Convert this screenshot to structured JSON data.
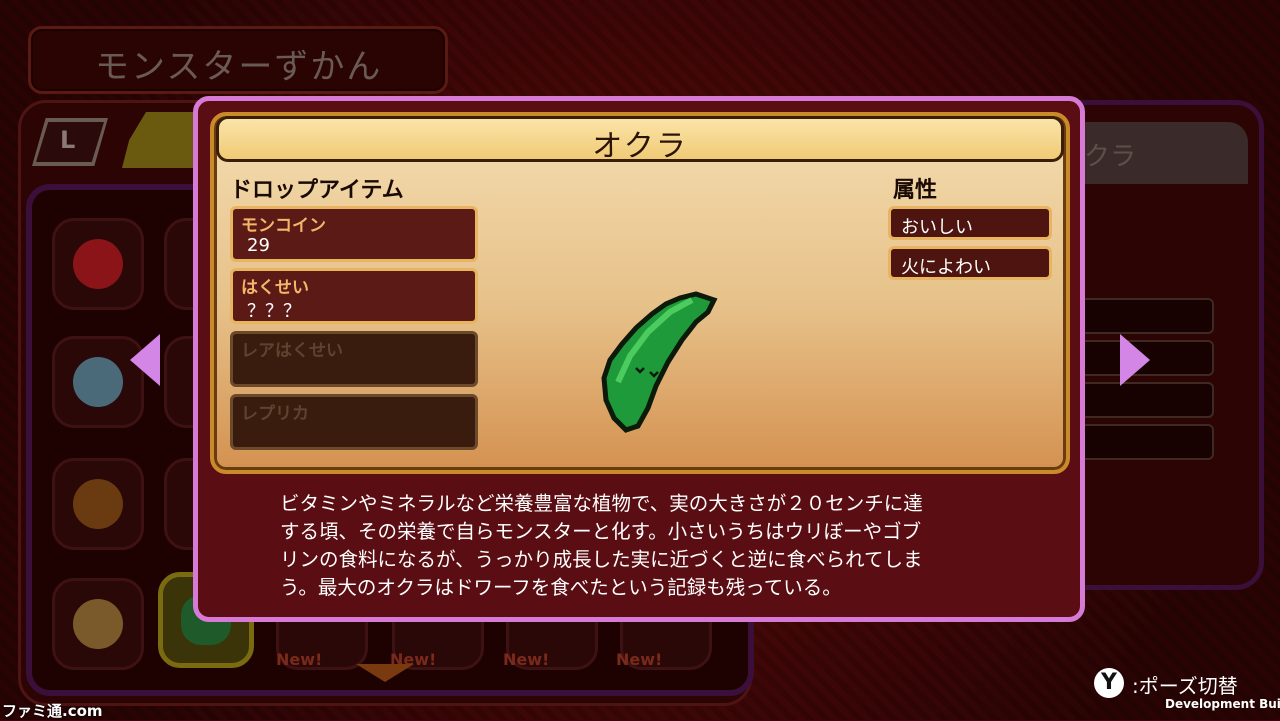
{
  "screen": {
    "title": "モンスターずかん",
    "tab_left_label": "L",
    "right_panel_title_partial": "クラ"
  },
  "card": {
    "monster_name": "オクラ",
    "drop_items_heading": "ドロップアイテム",
    "drop_items": [
      {
        "label": "モンコイン",
        "value": "29",
        "state": "filled"
      },
      {
        "label": "はくせい",
        "value": "？？？",
        "state": "filled"
      },
      {
        "label": "レアはくせい",
        "value": "",
        "state": "empty"
      },
      {
        "label": "レプリカ",
        "value": "",
        "state": "empty"
      }
    ],
    "attributes_heading": "属性",
    "attributes": [
      "おいしい",
      "火によわい"
    ],
    "monster_icon": "okra-sprite-icon"
  },
  "description": "ビタミンやミネラルなど栄養豊富な植物で、実の大きさが２０センチに達\nする頃、その栄養で自らモンスターと化す。小さいうちはウリぼーやゴブ\nリンの食料になるが、うっかり成長した実に近づくと逆に食べられてしま\nう。最大のオクラはドワーフを食べたという記録も残っている。",
  "new_tags": [
    "New!",
    "New!",
    "New!",
    "New!"
  ],
  "footer": {
    "button_glyph": "Y",
    "hint": ":ポーズ切替",
    "build_label": "Development Build",
    "watermark": "ファミ通.com"
  },
  "colors": {
    "modal_border": "#d67ad6",
    "accent_gold": "#e8b460",
    "background": "#3a0808"
  }
}
